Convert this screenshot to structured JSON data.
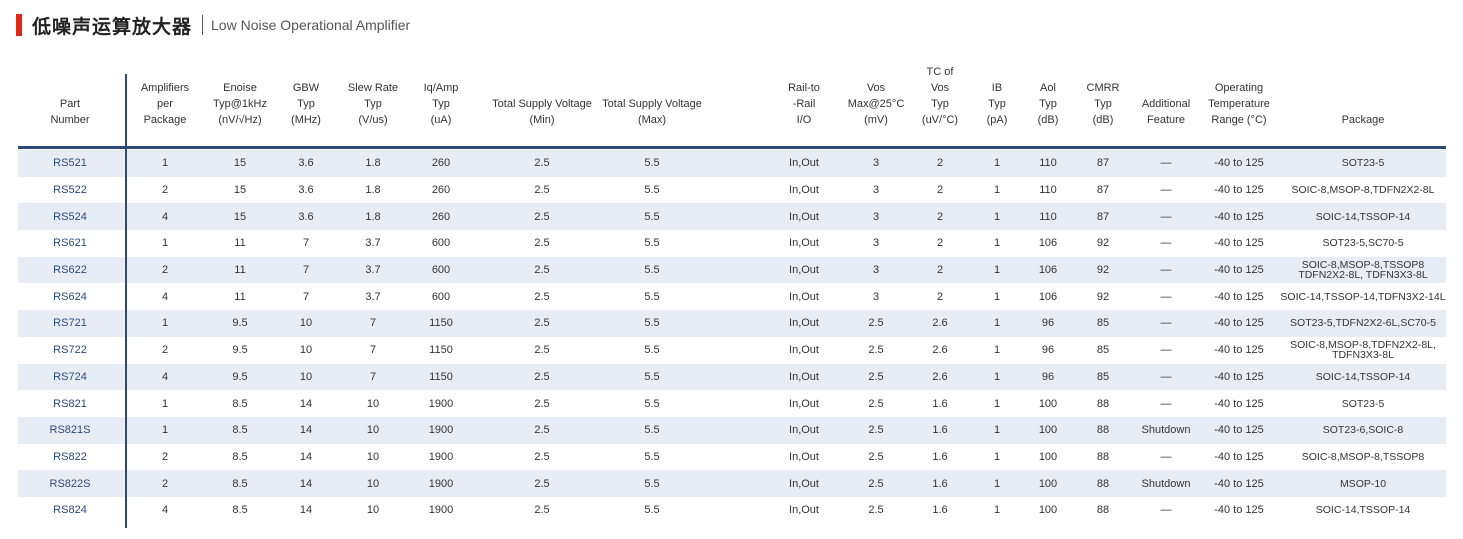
{
  "header": {
    "title_cn": "低噪声运算放大器",
    "title_en": "Low Noise Operational Amplifier",
    "accent_color": "#e0261b"
  },
  "table": {
    "columns": [
      {
        "key": "part",
        "label": "Part\nNumber"
      },
      {
        "key": "amps",
        "label": "Amplifiers\nper\nPackage"
      },
      {
        "key": "enoise",
        "label": "Enoise\nTyp@1kHz\n(nV/√Hz)"
      },
      {
        "key": "gbw",
        "label": "GBW\nTyp\n(MHz)"
      },
      {
        "key": "slew",
        "label": "Slew Rate\nTyp\n(V/us)"
      },
      {
        "key": "iq",
        "label": "Iq/Amp\nTyp\n(uA)"
      },
      {
        "key": "vmin",
        "label": "Total Supply Voltage\n(Min)"
      },
      {
        "key": "vmax",
        "label": "Total Supply Voltage\n(Max)"
      },
      {
        "key": "rail",
        "label": "Rail-to\n-Rail\nI/O"
      },
      {
        "key": "vos",
        "label": "Vos\nMax@25°C\n(mV)"
      },
      {
        "key": "tcvos",
        "label": "TC of\nVos\nTyp\n(uV/°C)"
      },
      {
        "key": "ib",
        "label": "IB\nTyp\n(pA)"
      },
      {
        "key": "aol",
        "label": "Aol\nTyp\n(dB)"
      },
      {
        "key": "cmrr",
        "label": "CMRR\nTyp\n(dB)"
      },
      {
        "key": "feature",
        "label": "Additional\nFeature"
      },
      {
        "key": "temp",
        "label": "Operating\nTemperature\nRange (°C)"
      },
      {
        "key": "package",
        "label": "Package"
      }
    ],
    "rows": [
      {
        "part": "RS521",
        "amps": "1",
        "enoise": "15",
        "gbw": "3.6",
        "slew": "1.8",
        "iq": "260",
        "vmin": "2.5",
        "vmax": "5.5",
        "rail": "In,Out",
        "vos": "3",
        "tcvos": "2",
        "ib": "1",
        "aol": "110",
        "cmrr": "87",
        "feature": "—",
        "temp": "-40 to 125",
        "package": "SOT23-5"
      },
      {
        "part": "RS522",
        "amps": "2",
        "enoise": "15",
        "gbw": "3.6",
        "slew": "1.8",
        "iq": "260",
        "vmin": "2.5",
        "vmax": "5.5",
        "rail": "In,Out",
        "vos": "3",
        "tcvos": "2",
        "ib": "1",
        "aol": "110",
        "cmrr": "87",
        "feature": "—",
        "temp": "-40 to 125",
        "package": "SOIC-8,MSOP-8,TDFN2X2-8L"
      },
      {
        "part": "RS524",
        "amps": "4",
        "enoise": "15",
        "gbw": "3.6",
        "slew": "1.8",
        "iq": "260",
        "vmin": "2.5",
        "vmax": "5.5",
        "rail": "In,Out",
        "vos": "3",
        "tcvos": "2",
        "ib": "1",
        "aol": "110",
        "cmrr": "87",
        "feature": "—",
        "temp": "-40 to 125",
        "package": "SOIC-14,TSSOP-14"
      },
      {
        "part": "RS621",
        "amps": "1",
        "enoise": "11",
        "gbw": "7",
        "slew": "3.7",
        "iq": "600",
        "vmin": "2.5",
        "vmax": "5.5",
        "rail": "In,Out",
        "vos": "3",
        "tcvos": "2",
        "ib": "1",
        "aol": "106",
        "cmrr": "92",
        "feature": "—",
        "temp": "-40 to 125",
        "package": "SOT23-5,SC70-5"
      },
      {
        "part": "RS622",
        "amps": "2",
        "enoise": "11",
        "gbw": "7",
        "slew": "3.7",
        "iq": "600",
        "vmin": "2.5",
        "vmax": "5.5",
        "rail": "In,Out",
        "vos": "3",
        "tcvos": "2",
        "ib": "1",
        "aol": "106",
        "cmrr": "92",
        "feature": "—",
        "temp": "-40 to 125",
        "package": "SOIC-8,MSOP-8,TSSOP8\nTDFN2X2-8L, TDFN3X3-8L"
      },
      {
        "part": "RS624",
        "amps": "4",
        "enoise": "11",
        "gbw": "7",
        "slew": "3.7",
        "iq": "600",
        "vmin": "2.5",
        "vmax": "5.5",
        "rail": "In,Out",
        "vos": "3",
        "tcvos": "2",
        "ib": "1",
        "aol": "106",
        "cmrr": "92",
        "feature": "—",
        "temp": "-40 to 125",
        "package": "SOIC-14,TSSOP-14,TDFN3X2-14L"
      },
      {
        "part": "RS721",
        "amps": "1",
        "enoise": "9.5",
        "gbw": "10",
        "slew": "7",
        "iq": "1150",
        "vmin": "2.5",
        "vmax": "5.5",
        "rail": "In,Out",
        "vos": "2.5",
        "tcvos": "2.6",
        "ib": "1",
        "aol": "96",
        "cmrr": "85",
        "feature": "—",
        "temp": "-40 to 125",
        "package": "SOT23-5,TDFN2X2-6L,SC70-5"
      },
      {
        "part": "RS722",
        "amps": "2",
        "enoise": "9.5",
        "gbw": "10",
        "slew": "7",
        "iq": "1150",
        "vmin": "2.5",
        "vmax": "5.5",
        "rail": "In,Out",
        "vos": "2.5",
        "tcvos": "2.6",
        "ib": "1",
        "aol": "96",
        "cmrr": "85",
        "feature": "—",
        "temp": "-40 to 125",
        "package": "SOIC-8,MSOP-8,TDFN2X2-8L,\nTDFN3X3-8L"
      },
      {
        "part": "RS724",
        "amps": "4",
        "enoise": "9.5",
        "gbw": "10",
        "slew": "7",
        "iq": "1150",
        "vmin": "2.5",
        "vmax": "5.5",
        "rail": "In,Out",
        "vos": "2.5",
        "tcvos": "2.6",
        "ib": "1",
        "aol": "96",
        "cmrr": "85",
        "feature": "—",
        "temp": "-40 to 125",
        "package": "SOIC-14,TSSOP-14"
      },
      {
        "part": "RS821",
        "amps": "1",
        "enoise": "8.5",
        "gbw": "14",
        "slew": "10",
        "iq": "1900",
        "vmin": "2.5",
        "vmax": "5.5",
        "rail": "In,Out",
        "vos": "2.5",
        "tcvos": "1.6",
        "ib": "1",
        "aol": "100",
        "cmrr": "88",
        "feature": "—",
        "temp": "-40 to 125",
        "package": "SOT23-5"
      },
      {
        "part": "RS821S",
        "amps": "1",
        "enoise": "8.5",
        "gbw": "14",
        "slew": "10",
        "iq": "1900",
        "vmin": "2.5",
        "vmax": "5.5",
        "rail": "In,Out",
        "vos": "2.5",
        "tcvos": "1.6",
        "ib": "1",
        "aol": "100",
        "cmrr": "88",
        "feature": "Shutdown",
        "temp": "-40 to 125",
        "package": "SOT23-6,SOIC-8"
      },
      {
        "part": "RS822",
        "amps": "2",
        "enoise": "8.5",
        "gbw": "14",
        "slew": "10",
        "iq": "1900",
        "vmin": "2.5",
        "vmax": "5.5",
        "rail": "In,Out",
        "vos": "2.5",
        "tcvos": "1.6",
        "ib": "1",
        "aol": "100",
        "cmrr": "88",
        "feature": "—",
        "temp": "-40 to 125",
        "package": "SOIC-8,MSOP-8,TSSOP8"
      },
      {
        "part": "RS822S",
        "amps": "2",
        "enoise": "8.5",
        "gbw": "14",
        "slew": "10",
        "iq": "1900",
        "vmin": "2.5",
        "vmax": "5.5",
        "rail": "In,Out",
        "vos": "2.5",
        "tcvos": "1.6",
        "ib": "1",
        "aol": "100",
        "cmrr": "88",
        "feature": "Shutdown",
        "temp": "-40 to 125",
        "package": "MSOP-10"
      },
      {
        "part": "RS824",
        "amps": "4",
        "enoise": "8.5",
        "gbw": "14",
        "slew": "10",
        "iq": "1900",
        "vmin": "2.5",
        "vmax": "5.5",
        "rail": "In,Out",
        "vos": "2.5",
        "tcvos": "1.6",
        "ib": "1",
        "aol": "100",
        "cmrr": "88",
        "feature": "—",
        "temp": "-40 to 125",
        "package": "SOIC-14,TSSOP-14"
      }
    ]
  }
}
